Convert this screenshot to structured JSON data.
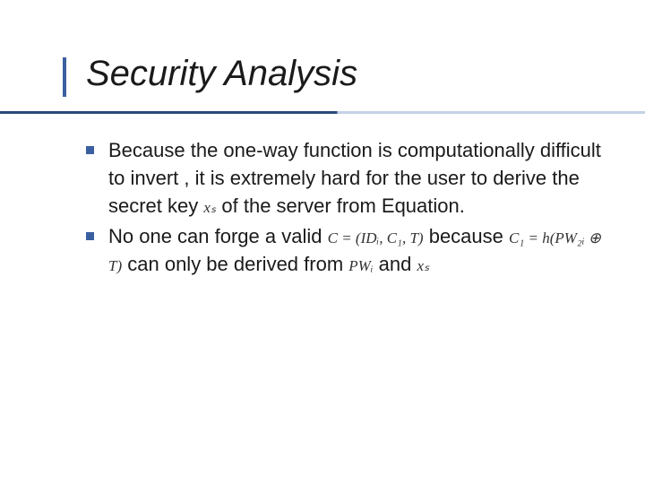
{
  "slide": {
    "title": "Security Analysis",
    "bullets": [
      {
        "text_a": "Because the one-way function is computationally difficult to invert , it is extremely hard for the user",
        "inline1": "",
        "text_b": " to derive the secret key ",
        "inline2": "xₛ",
        "text_c": " of the server from Equation."
      },
      {
        "text_a": "No one can forge a valid ",
        "inline1": "C = (IDᵢ, C₁, T)",
        "text_b": " because ",
        "inline2": "C₁ = h(PW₂ᵢ ⊕ T)",
        "text_c": " can only be derived from ",
        "inline3": "PWᵢ",
        "text_d": " and ",
        "inline4": "xₛ"
      }
    ]
  }
}
